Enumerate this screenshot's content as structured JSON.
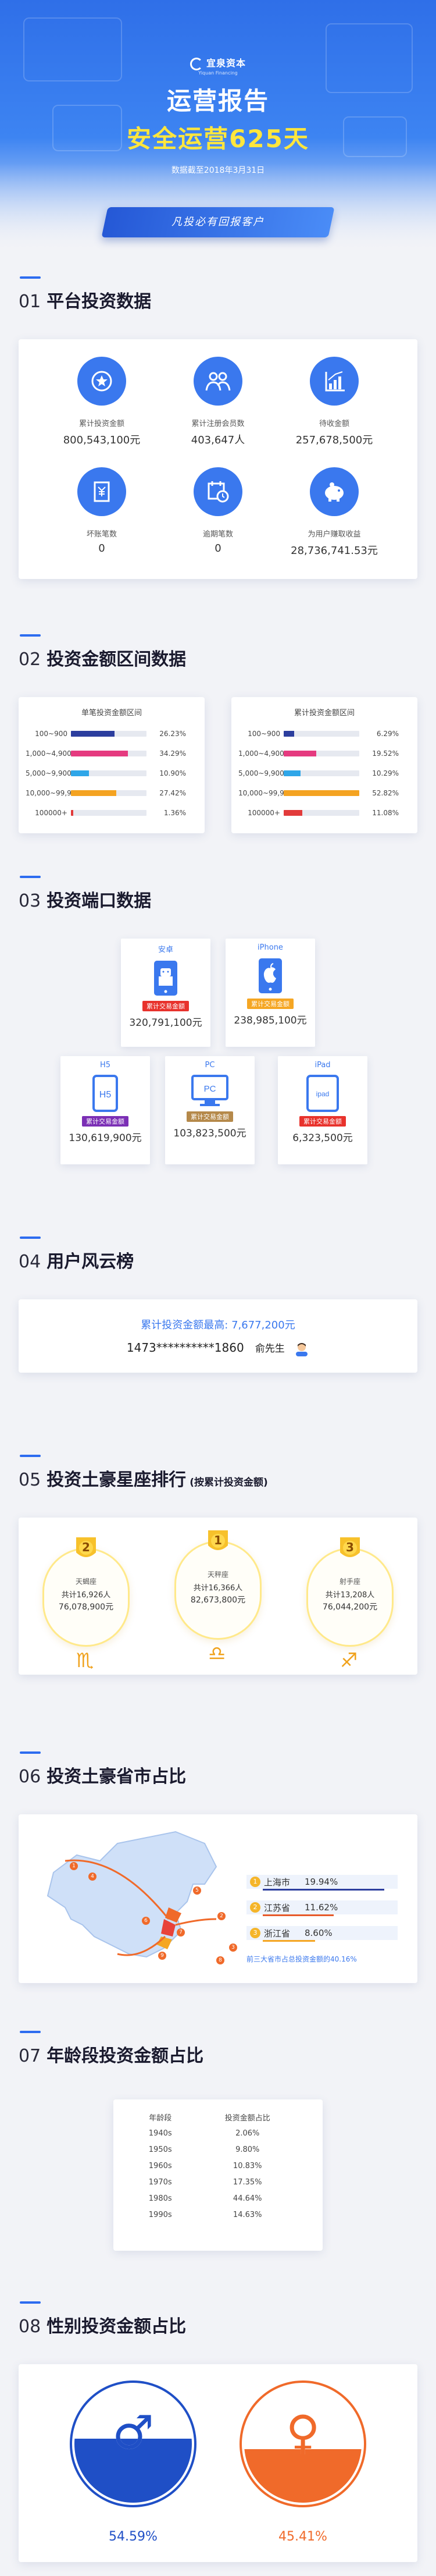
{
  "header": {
    "brand_name": "宜泉资本",
    "brand_en": "Yiquan Financing",
    "title": "运营报告",
    "subtitle": "安全运营625天",
    "date_note": "数据截至2018年3月31日",
    "slogan": "凡投必有回报客户"
  },
  "s1": {
    "num": "01",
    "title": "平台投资数据",
    "stats": [
      {
        "label": "累计投资金额",
        "value": "800,543,100元",
        "icon": "medal-icon"
      },
      {
        "label": "累计注册会员数",
        "value": "403,647人",
        "icon": "users-icon"
      },
      {
        "label": "待收金额",
        "value": "257,678,500元",
        "icon": "growth-chart-icon"
      },
      {
        "label": "坏账笔数",
        "value": "0",
        "icon": "document-yen-icon"
      },
      {
        "label": "逾期笔数",
        "value": "0",
        "icon": "calendar-clock-icon"
      },
      {
        "label": "为用户赚取收益",
        "value": "28,736,741.53元",
        "icon": "piggy-bank-icon"
      }
    ]
  },
  "s2": {
    "num": "02",
    "title": "投资金额区间数据",
    "left": {
      "title": "单笔投资金额区间",
      "rows": [
        {
          "range": "100~900",
          "pct": "26.23%",
          "frac": 0.2623,
          "color": "#2c3e9e"
        },
        {
          "range": "1,000~4,900",
          "pct": "34.29%",
          "frac": 0.3429,
          "color": "#e53a7f"
        },
        {
          "range": "5,000~9,900",
          "pct": "10.90%",
          "frac": 0.109,
          "color": "#2fa6e8"
        },
        {
          "range": "10,000~99,900",
          "pct": "27.42%",
          "frac": 0.2742,
          "color": "#f4a321"
        },
        {
          "range": "100000+",
          "pct": "1.36%",
          "frac": 0.0136,
          "color": "#e23b3b"
        }
      ]
    },
    "right": {
      "title": "累计投资金额区间",
      "rows": [
        {
          "range": "100~900",
          "pct": "6.29%",
          "frac": 0.0629,
          "color": "#2c3e9e"
        },
        {
          "range": "1,000~4,900",
          "pct": "19.52%",
          "frac": 0.1952,
          "color": "#e53a7f"
        },
        {
          "range": "5,000~9,900",
          "pct": "10.29%",
          "frac": 0.1029,
          "color": "#2fa6e8"
        },
        {
          "range": "10,000~99,900",
          "pct": "52.82%",
          "frac": 0.5282,
          "color": "#f4a321"
        },
        {
          "range": "100000+",
          "pct": "11.08%",
          "frac": 0.1108,
          "color": "#e23b3b"
        }
      ]
    }
  },
  "s3": {
    "num": "03",
    "title": "投资端口数据",
    "pill_label": "累计交易金额",
    "devices": [
      {
        "name": "安卓",
        "amount": "320,791,100元",
        "pill_color": "#e8322c",
        "icon": "android-phone-icon"
      },
      {
        "name": "iPhone",
        "amount": "238,985,100元",
        "pill_color": "#f5a623",
        "icon": "iphone-icon"
      },
      {
        "name": "H5",
        "amount": "130,619,900元",
        "pill_color": "#7b2fb5",
        "icon": "h5-phone-icon"
      },
      {
        "name": "PC",
        "amount": "103,823,500元",
        "pill_color": "#b5894a",
        "icon": "pc-monitor-icon"
      },
      {
        "name": "iPad",
        "amount": "6,323,500元",
        "pill_color": "#e8322c",
        "icon": "ipad-icon"
      }
    ],
    "h5_glyph": "H5",
    "pc_glyph": "PC",
    "ipad_glyph": "ipad"
  },
  "s4": {
    "num": "04",
    "title": "用户风云榜",
    "label": "累计投资金额最高:",
    "amount": "7,677,200元",
    "phone": "1473**********1860",
    "user": "俞先生"
  },
  "s5": {
    "num": "05",
    "title": "投资土豪星座排行",
    "subtitle": "(按累计投资金额)",
    "signs": [
      {
        "rank": "2",
        "name": "天蝎座",
        "count": "共计16,926人",
        "amount": "76,078,900元",
        "symbol": "♏"
      },
      {
        "rank": "1",
        "name": "天秤座",
        "count": "共计16,366人",
        "amount": "82,673,800元",
        "symbol": "♎"
      },
      {
        "rank": "3",
        "name": "射手座",
        "count": "共计13,208人",
        "amount": "76,044,200元",
        "symbol": "♐"
      }
    ]
  },
  "s6": {
    "num": "06",
    "title": "投资土豪省市占比",
    "provinces": [
      {
        "rank": "1",
        "name": "上海市",
        "pct": "19.94%",
        "frac": 0.1994,
        "color": "#2c3e9e"
      },
      {
        "rank": "2",
        "name": "江苏省",
        "pct": "11.62%",
        "frac": 0.1162,
        "color": "#e85a2a"
      },
      {
        "rank": "3",
        "name": "浙江省",
        "pct": "8.60%",
        "frac": 0.086,
        "color": "#f5a623"
      }
    ],
    "note": "前三大省市占总投资金额的40.16%",
    "map_labels": [
      "1",
      "2",
      "3",
      "4",
      "5",
      "6",
      "7",
      "8",
      "9"
    ]
  },
  "s7": {
    "num": "07",
    "title": "年龄段投资金额占比",
    "headers": [
      "年龄段",
      "投资金额占比"
    ],
    "rows": [
      [
        "1940s",
        "2.06%"
      ],
      [
        "1950s",
        "9.80%"
      ],
      [
        "1960s",
        "10.83%"
      ],
      [
        "1970s",
        "17.35%"
      ],
      [
        "1980s",
        "44.64%"
      ],
      [
        "1990s",
        "14.63%"
      ]
    ]
  },
  "s8": {
    "num": "08",
    "title": "性别投资金额占比",
    "male": {
      "symbol": "♂",
      "pct": "54.59%",
      "frac": 0.5459,
      "color": "#1f4fc6"
    },
    "female": {
      "symbol": "♀",
      "pct": "45.41%",
      "frac": 0.4541,
      "color": "#f06a2a"
    }
  }
}
